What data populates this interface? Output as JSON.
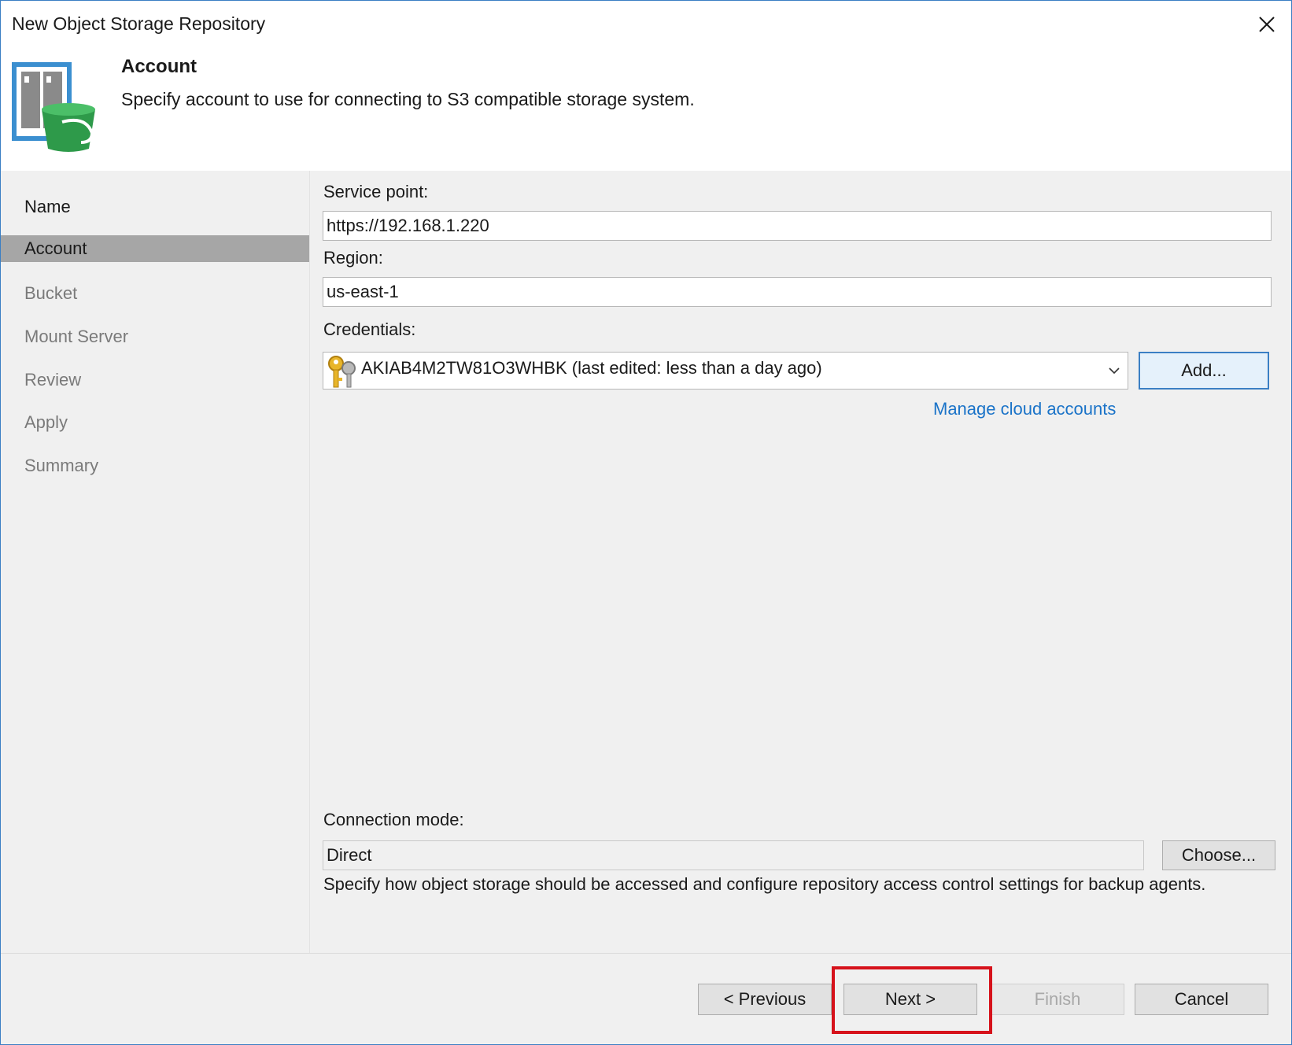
{
  "window": {
    "title": "New Object Storage Repository",
    "close_icon": "close-icon"
  },
  "header": {
    "title": "Account",
    "description": "Specify account to use for connecting to S3 compatible storage system.",
    "icon": "object-storage-bucket-icon"
  },
  "sidebar": {
    "items": [
      {
        "label": "Name",
        "state": "done"
      },
      {
        "label": "Account",
        "state": "active"
      },
      {
        "label": "Bucket",
        "state": "pending"
      },
      {
        "label": "Mount Server",
        "state": "pending"
      },
      {
        "label": "Review",
        "state": "pending"
      },
      {
        "label": "Apply",
        "state": "pending"
      },
      {
        "label": "Summary",
        "state": "pending"
      }
    ]
  },
  "form": {
    "service_point_label": "Service point:",
    "service_point_value": "https://192.168.1.220",
    "region_label": "Region:",
    "region_value": "us-east-1",
    "credentials_label": "Credentials:",
    "credentials_value": "AKIAB4M2TW81O3WHBK (last edited: less than a day ago)",
    "credentials_icon": "key-icon",
    "add_button": "Add...",
    "manage_link": "Manage cloud accounts",
    "connection_mode_label": "Connection mode:",
    "connection_mode_value": "Direct",
    "choose_button": "Choose...",
    "connection_hint": "Specify how object storage should be accessed and configure repository access control settings for backup agents."
  },
  "footer": {
    "previous_button": "< Previous",
    "next_button": "Next >",
    "finish_button": "Finish",
    "cancel_button": "Cancel"
  },
  "colors": {
    "accent": "#3b7fc4",
    "link": "#1a73c8",
    "highlight": "#d6121b",
    "active_nav": "#a6a6a6"
  }
}
